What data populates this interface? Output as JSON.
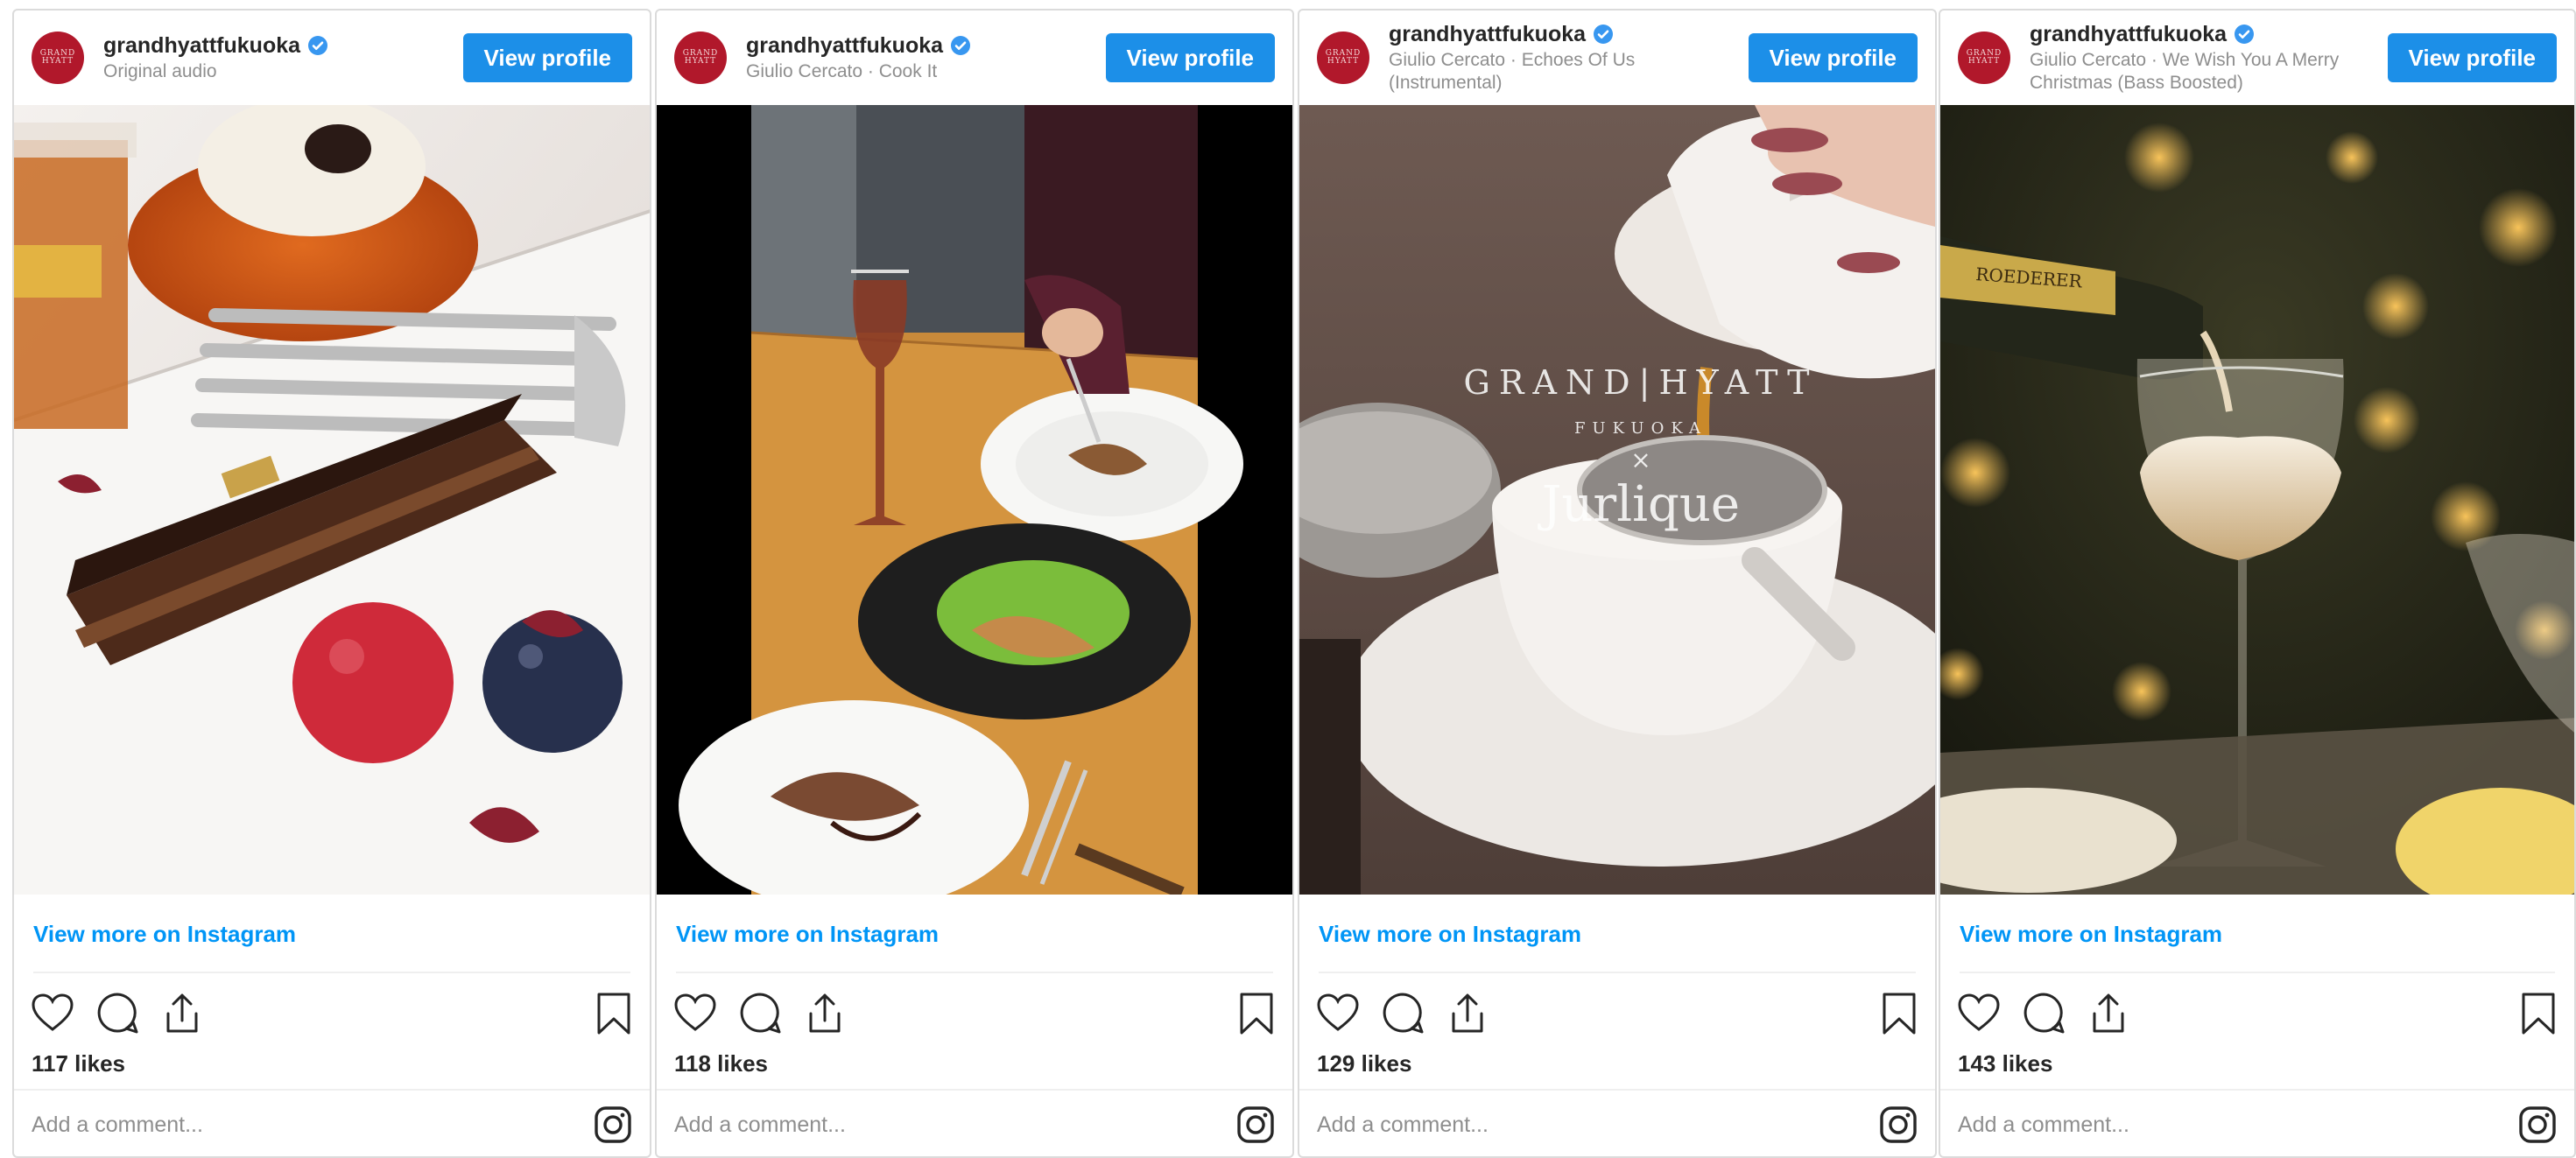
{
  "posts": [
    {
      "username": "grandhyattfukuoka",
      "avatar_text": "GRAND HYATT",
      "audio": "Original audio",
      "view_profile": "View profile",
      "view_more": "View more on Instagram",
      "likes": "117 likes",
      "comment_placeholder": "Add a comment..."
    },
    {
      "username": "grandhyattfukuoka",
      "avatar_text": "GRAND HYATT",
      "audio": "Giulio Cercato · Cook It",
      "view_profile": "View profile",
      "view_more": "View more on Instagram",
      "likes": "118 likes",
      "comment_placeholder": "Add a comment..."
    },
    {
      "username": "grandhyattfukuoka",
      "avatar_text": "GRAND HYATT",
      "audio": "Giulio Cercato · Echoes Of Us (Instrumental)",
      "view_profile": "View profile",
      "view_more": "View more on Instagram",
      "likes": "129 likes",
      "comment_placeholder": "Add a comment...",
      "overlay_brand": "GRAND|HYATT",
      "overlay_city": "FUKUOKA",
      "overlay_x": "×",
      "overlay_partner": "Jurlique"
    },
    {
      "username": "grandhyattfukuoka",
      "avatar_text": "GRAND HYATT",
      "audio": "Giulio Cercato · We Wish You A Merry Christmas (Bass Boosted)",
      "view_profile": "View profile",
      "view_more": "View more on Instagram",
      "likes": "143 likes",
      "comment_placeholder": "Add a comment...",
      "bottle_label": "ROEDERER"
    }
  ],
  "colors": {
    "accent": "#1c8fe8",
    "link": "#0095f6",
    "verified": "#3897f0",
    "avatar": "#b1182b"
  },
  "icons": [
    "heart-icon",
    "comment-icon",
    "share-icon",
    "bookmark-icon",
    "instagram-icon",
    "verified-badge-icon"
  ]
}
